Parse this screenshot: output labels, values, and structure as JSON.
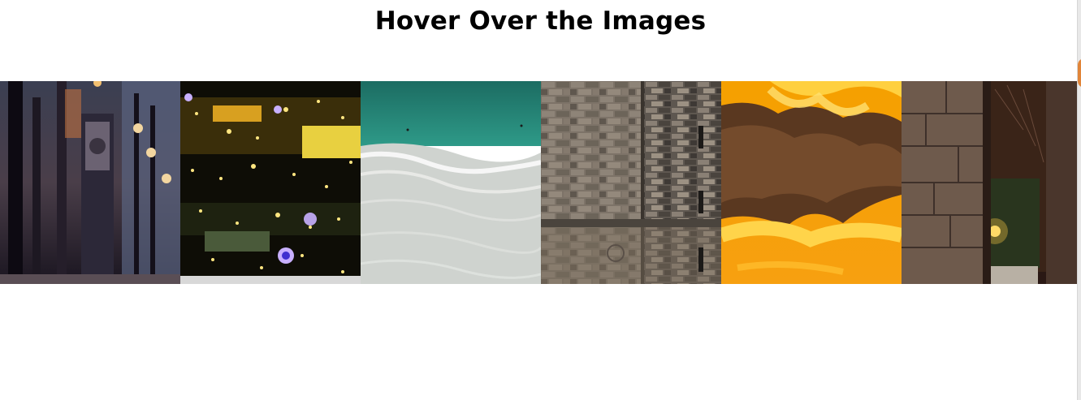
{
  "page": {
    "title": "Hover Over the Images"
  },
  "gallery": {
    "images": [
      {
        "name": "city-street-night"
      },
      {
        "name": "city-lights-aerial"
      },
      {
        "name": "sea-shore-waves"
      },
      {
        "name": "stone-tower-wall"
      },
      {
        "name": "fiery-sunset-clouds"
      },
      {
        "name": "stone-arch-gate"
      }
    ]
  }
}
